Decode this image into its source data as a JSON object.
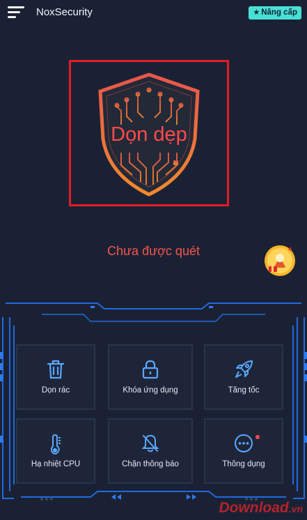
{
  "header": {
    "app_title": "NoxSecurity",
    "upgrade_label": "Nâng cấp"
  },
  "shield": {
    "label": "Dọn dẹp"
  },
  "status": {
    "text": "Chưa được quét"
  },
  "tiles": [
    {
      "label": "Dọn rác",
      "icon": "trash-icon"
    },
    {
      "label": "Khóa ứng dụng",
      "icon": "lock-icon"
    },
    {
      "label": "Tăng tốc",
      "icon": "rocket-icon"
    },
    {
      "label": "Hạ nhiệt CPU",
      "icon": "thermometer-icon"
    },
    {
      "label": "Chặn thông báo",
      "icon": "bell-off-icon"
    },
    {
      "label": "Thông dụng",
      "icon": "more-icon"
    }
  ],
  "watermark": {
    "main": "Download",
    "suffix": ".vn"
  },
  "colors": {
    "background": "#1b2134",
    "accent_cyan": "#48e0d6",
    "frame_blue": "#1e6be0",
    "status_red": "#f2564f",
    "highlight_box": "#e41b24"
  }
}
